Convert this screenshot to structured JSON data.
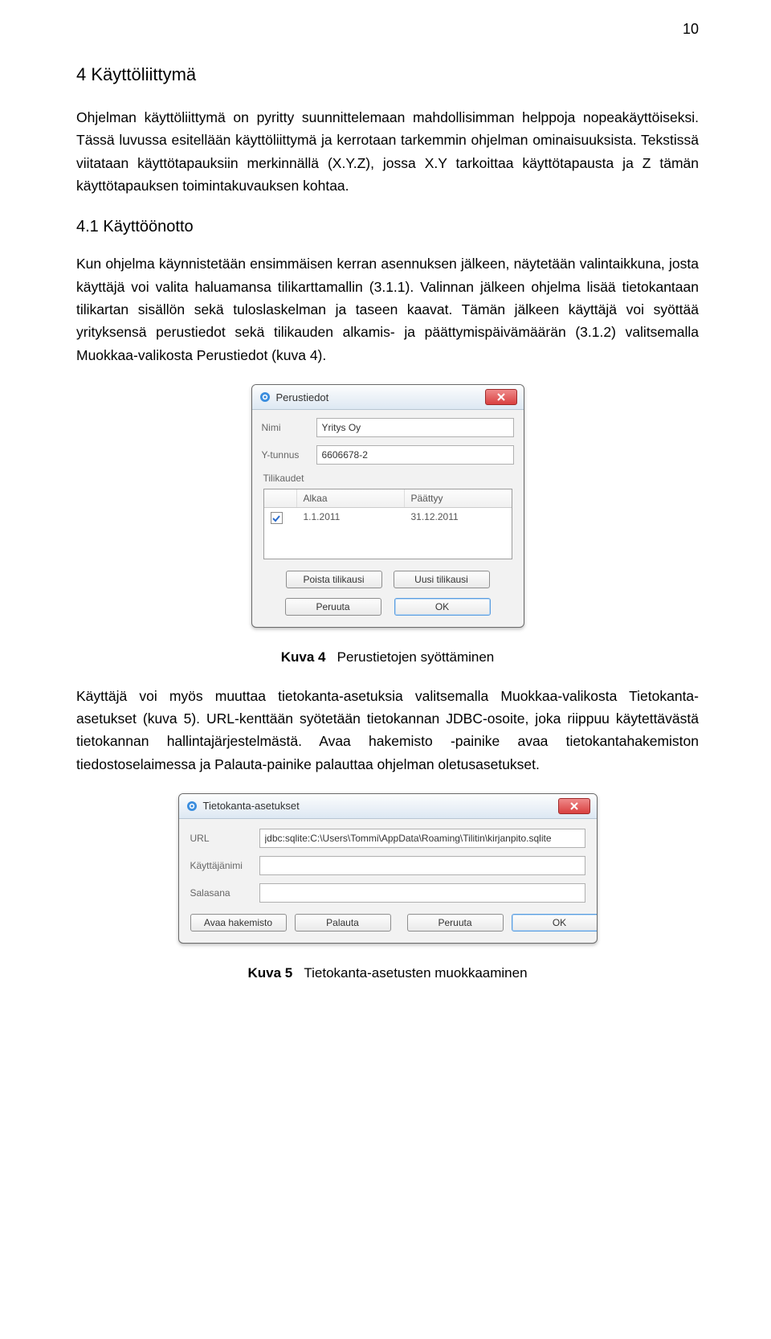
{
  "pageNumber": "10",
  "section": {
    "heading": "4   Käyttöliittymä",
    "p1": "Ohjelman käyttöliittymä on pyritty suunnittelemaan mahdollisimman helppoja nopeakäyttöiseksi. Tässä luvussa esitellään käyttöliittymä ja kerrotaan tarkemmin ohjelman ominaisuuksista. Tekstissä viitataan käyttötapauksiin merkinnällä (X.Y.Z), jossa X.Y tarkoittaa käyttötapausta ja Z tämän käyttötapauksen toimintakuvauksen kohtaa.",
    "subheading": "4.1   Käyttöönotto",
    "p2": "Kun ohjelma käynnistetään ensimmäisen kerran asennuksen jälkeen, näytetään valintaikkuna, josta käyttäjä voi valita haluamansa tilikarttamallin (3.1.1). Valinnan jälkeen ohjelma lisää tietokantaan tilikartan sisällön sekä tuloslaskelman ja taseen kaavat. Tämän jälkeen käyttäjä voi syöttää yrityksensä perustiedot sekä tilikauden alkamis- ja päättymispäivämäärän (3.1.2) valitsemalla Muokkaa-valikosta Perustiedot (kuva 4).",
    "fig4_label": "Kuva 4",
    "fig4_caption": "Perustietojen syöttäminen",
    "p3": "Käyttäjä voi myös muuttaa tietokanta-asetuksia valitsemalla Muokkaa-valikosta Tietokanta-asetukset (kuva 5). URL-kenttään syötetään tietokannan JDBC-osoite, joka riippuu käytettävästä tietokannan hallintajärjestelmästä. Avaa hakemisto -painike avaa tietokantahakemiston tiedostoselaimessa ja Palauta-painike palauttaa ohjelman oletusasetukset.",
    "fig5_label": "Kuva 5",
    "fig5_caption": "Tietokanta-asetusten muokkaaminen"
  },
  "dialog1": {
    "title": "Perustiedot",
    "name_label": "Nimi",
    "name_value": "Yritys Oy",
    "ytunnus_label": "Y-tunnus",
    "ytunnus_value": "6606678-2",
    "periods_label": "Tilikaudet",
    "col_begin": "Alkaa",
    "col_end": "Päättyy",
    "row_begin": "1.1.2011",
    "row_end": "31.12.2011",
    "btn_remove_period": "Poista tilikausi",
    "btn_new_period": "Uusi tilikausi",
    "btn_cancel": "Peruuta",
    "btn_ok": "OK"
  },
  "dialog2": {
    "title": "Tietokanta-asetukset",
    "url_label": "URL",
    "url_value": "jdbc:sqlite:C:\\Users\\Tommi\\AppData\\Roaming\\Tilitin\\kirjanpito.sqlite",
    "user_label": "Käyttäjänimi",
    "pass_label": "Salasana",
    "btn_open_dir": "Avaa hakemisto",
    "btn_restore": "Palauta",
    "btn_cancel": "Peruuta",
    "btn_ok": "OK"
  }
}
